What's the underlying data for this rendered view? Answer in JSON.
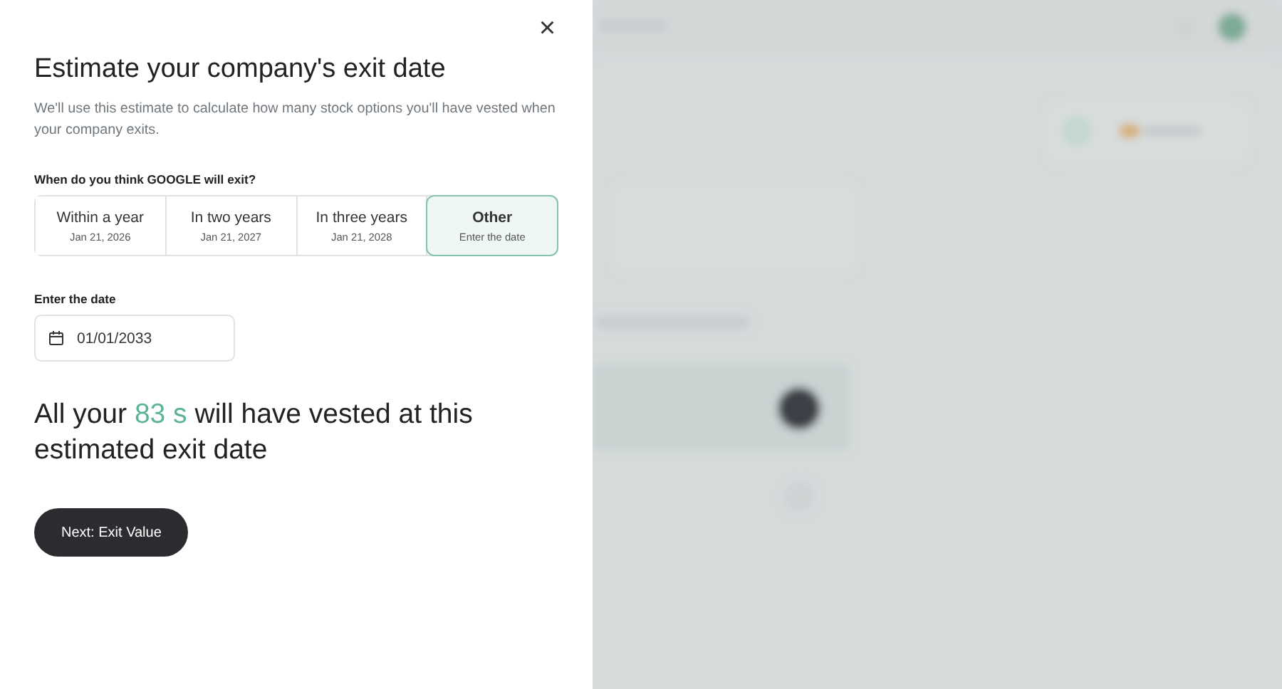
{
  "dialog": {
    "close_icon": "×",
    "title": "Estimate your company's exit date",
    "subtitle": "We'll use this estimate to calculate how many stock options you'll have vested when your company exits.",
    "question": "When do you think GOOGLE will exit?",
    "options": [
      {
        "label": "Within a year",
        "sublabel": "Jan 21, 2026",
        "selected": false
      },
      {
        "label": "In two years",
        "sublabel": "Jan 21, 2027",
        "selected": false
      },
      {
        "label": "In three years",
        "sublabel": "Jan 21, 2028",
        "selected": false
      },
      {
        "label": "Other",
        "sublabel": "Enter the date",
        "selected": true
      }
    ],
    "date_label": "Enter the date",
    "date_field": {
      "value": "01/01/2033"
    },
    "summary": {
      "before": "All your",
      "highlight": "83 s",
      "after": "will have vested at this estimated exit date"
    },
    "next_button": "Next: Exit Value"
  }
}
